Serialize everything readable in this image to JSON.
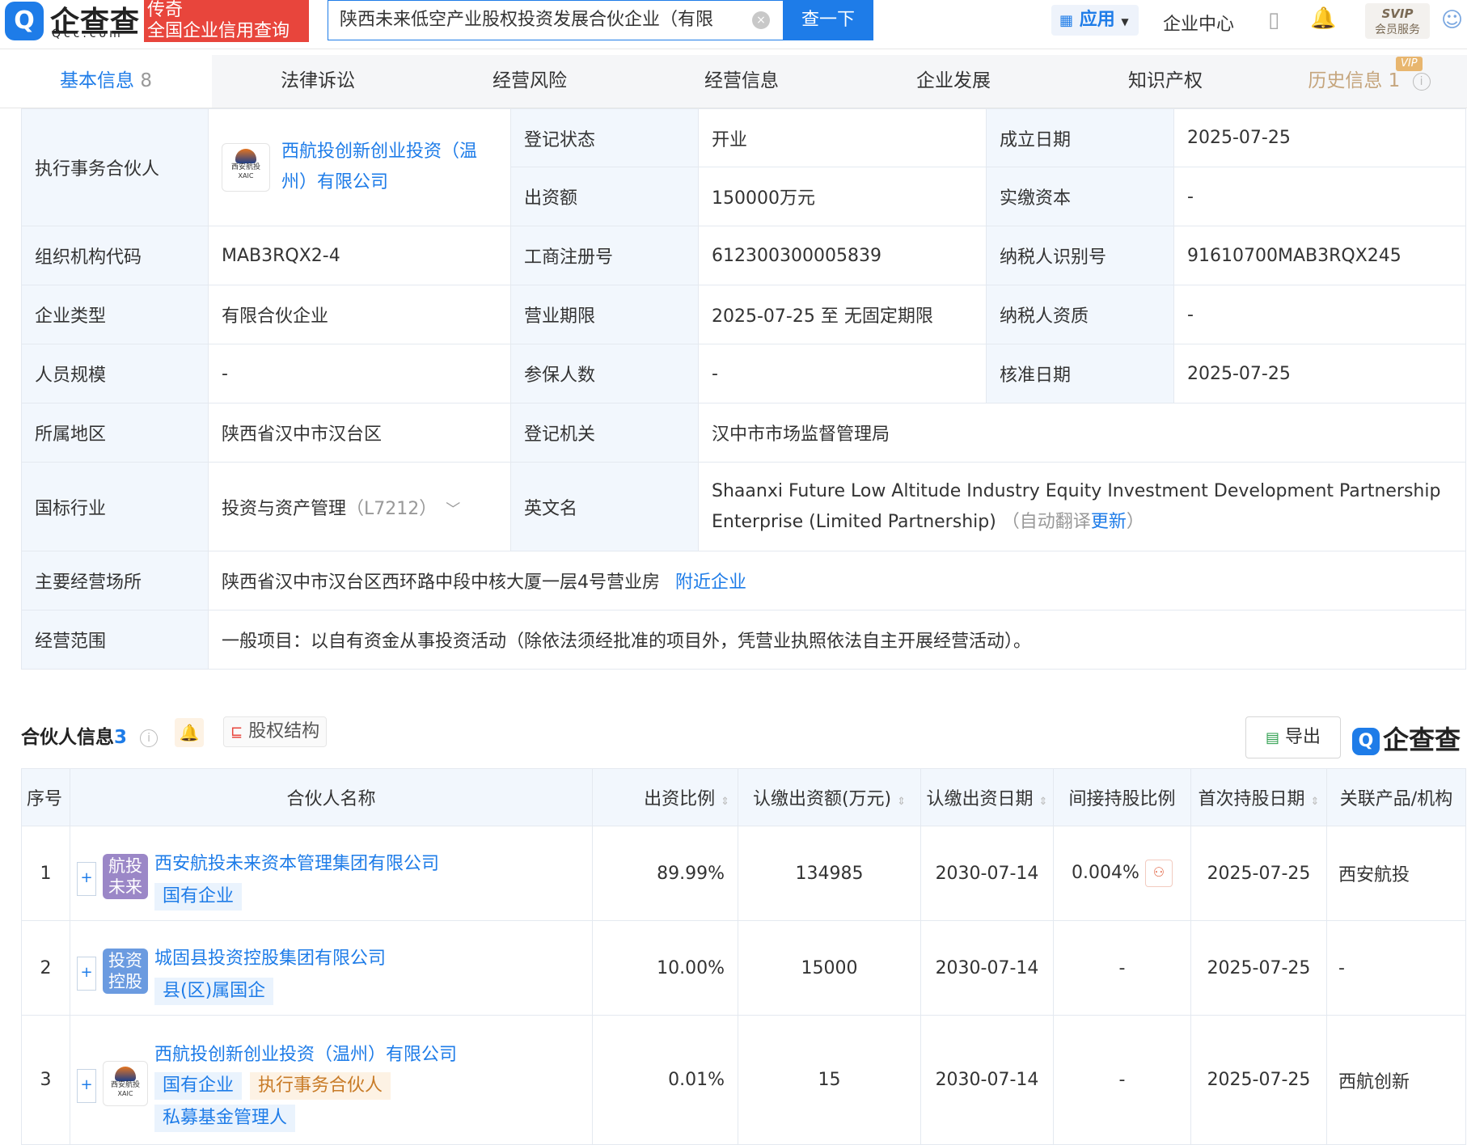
{
  "header": {
    "logo_text": "企查查",
    "logo_url": "Qcc.com",
    "promo_line1": "传奇",
    "promo_line2": "全国企业信用查询",
    "search_value": "陕西未来低空产业股权投资发展合伙企业（有限",
    "search_button": "查一下",
    "app_menu": "应用",
    "enterprise_center": "企业中心",
    "svip_line1": "SVIP",
    "svip_line2": "会员服务"
  },
  "tabs": [
    {
      "label": "基本信息",
      "count": "8"
    },
    {
      "label": "法律诉讼"
    },
    {
      "label": "经营风险"
    },
    {
      "label": "经营信息"
    },
    {
      "label": "企业发展"
    },
    {
      "label": "知识产权"
    },
    {
      "label": "历史信息",
      "count": "1",
      "badge": "VIP"
    }
  ],
  "basic_info": {
    "exec_partner_label": "执行事务合伙人",
    "exec_partner_name": "西航投创新创业投资（温州）有限公司",
    "exec_partner_logo_text": "西安航投",
    "exec_partner_logo_sub": "XAIC",
    "reg_status_label": "登记状态",
    "reg_status": "开业",
    "founded_label": "成立日期",
    "founded": "2025-07-25",
    "capital_label": "出资额",
    "capital": "150000万元",
    "paid_label": "实缴资本",
    "paid": "-",
    "org_code_label": "组织机构代码",
    "org_code": "MAB3RQX2-4",
    "biz_reg_label": "工商注册号",
    "biz_reg": "612300300005839",
    "tax_id_label": "纳税人识别号",
    "tax_id": "91610700MAB3RQX245",
    "type_label": "企业类型",
    "type": "有限合伙企业",
    "term_label": "营业期限",
    "term": "2025-07-25 至 无固定期限",
    "tax_qual_label": "纳税人资质",
    "tax_qual": "-",
    "staff_label": "人员规模",
    "staff": "-",
    "insured_label": "参保人数",
    "insured": "-",
    "approved_label": "核准日期",
    "approved": "2025-07-25",
    "region_label": "所属地区",
    "region": "陕西省汉中市汉台区",
    "authority_label": "登记机关",
    "authority": "汉中市市场监督管理局",
    "industry_label": "国标行业",
    "industry": "投资与资产管理",
    "industry_code": "（L7212）",
    "en_name_label": "英文名",
    "en_name": "Shaanxi Future Low Altitude Industry Equity Investment Development Partnership Enterprise (Limited Partnership)",
    "en_name_note_prefix": "（自动翻译",
    "en_name_update": "更新",
    "en_name_note_suffix": "）",
    "address_label": "主要经营场所",
    "address": "陕西省汉中市汉台区西环路中段中核大厦一层4号营业房",
    "nearby": "附近企业",
    "scope_label": "经营范围",
    "scope": "一般项目：以自有资金从事投资活动（除依法须经批准的项目外，凭营业执照依法自主开展经营活动）。"
  },
  "partners": {
    "title": "合伙人信息",
    "count": "3",
    "equity_button": "股权结构",
    "export_button": "导出",
    "watermark": "企查查",
    "columns": [
      "序号",
      "合伙人名称",
      "出资比例",
      "认缴出资额(万元)",
      "认缴出资日期",
      "间接持股比例",
      "首次持股日期",
      "关联产品/机构"
    ],
    "rows": [
      {
        "no": "1",
        "avatar": [
          "航投",
          "未来"
        ],
        "avatar_color": "#9b87c7",
        "name": "西安航投未来资本管理集团有限公司",
        "tags": [
          "国有企业"
        ],
        "ratio": "89.99%",
        "amount": "134985",
        "date": "2030-07-14",
        "indirect": "0.004%",
        "first": "2025-07-25",
        "product": "西安航投"
      },
      {
        "no": "2",
        "avatar": [
          "投资",
          "控股"
        ],
        "avatar_color": "#6b9be0",
        "name": "城固县投资控股集团有限公司",
        "tags": [
          "县(区)属国企"
        ],
        "ratio": "10.00%",
        "amount": "15000",
        "date": "2030-07-14",
        "indirect": "-",
        "first": "2025-07-25",
        "product": "-"
      },
      {
        "no": "3",
        "avatar_logo": "西安航投",
        "avatar_logo_sub": "XAIC",
        "name": "西航投创新创业投资（温州）有限公司",
        "tags": [
          "国有企业"
        ],
        "tag_orange": "执行事务合伙人",
        "tag_extra": "私募基金管理人",
        "ratio": "0.01%",
        "amount": "15",
        "date": "2030-07-14",
        "indirect": "-",
        "first": "2025-07-25",
        "product": "西航创新"
      }
    ]
  }
}
